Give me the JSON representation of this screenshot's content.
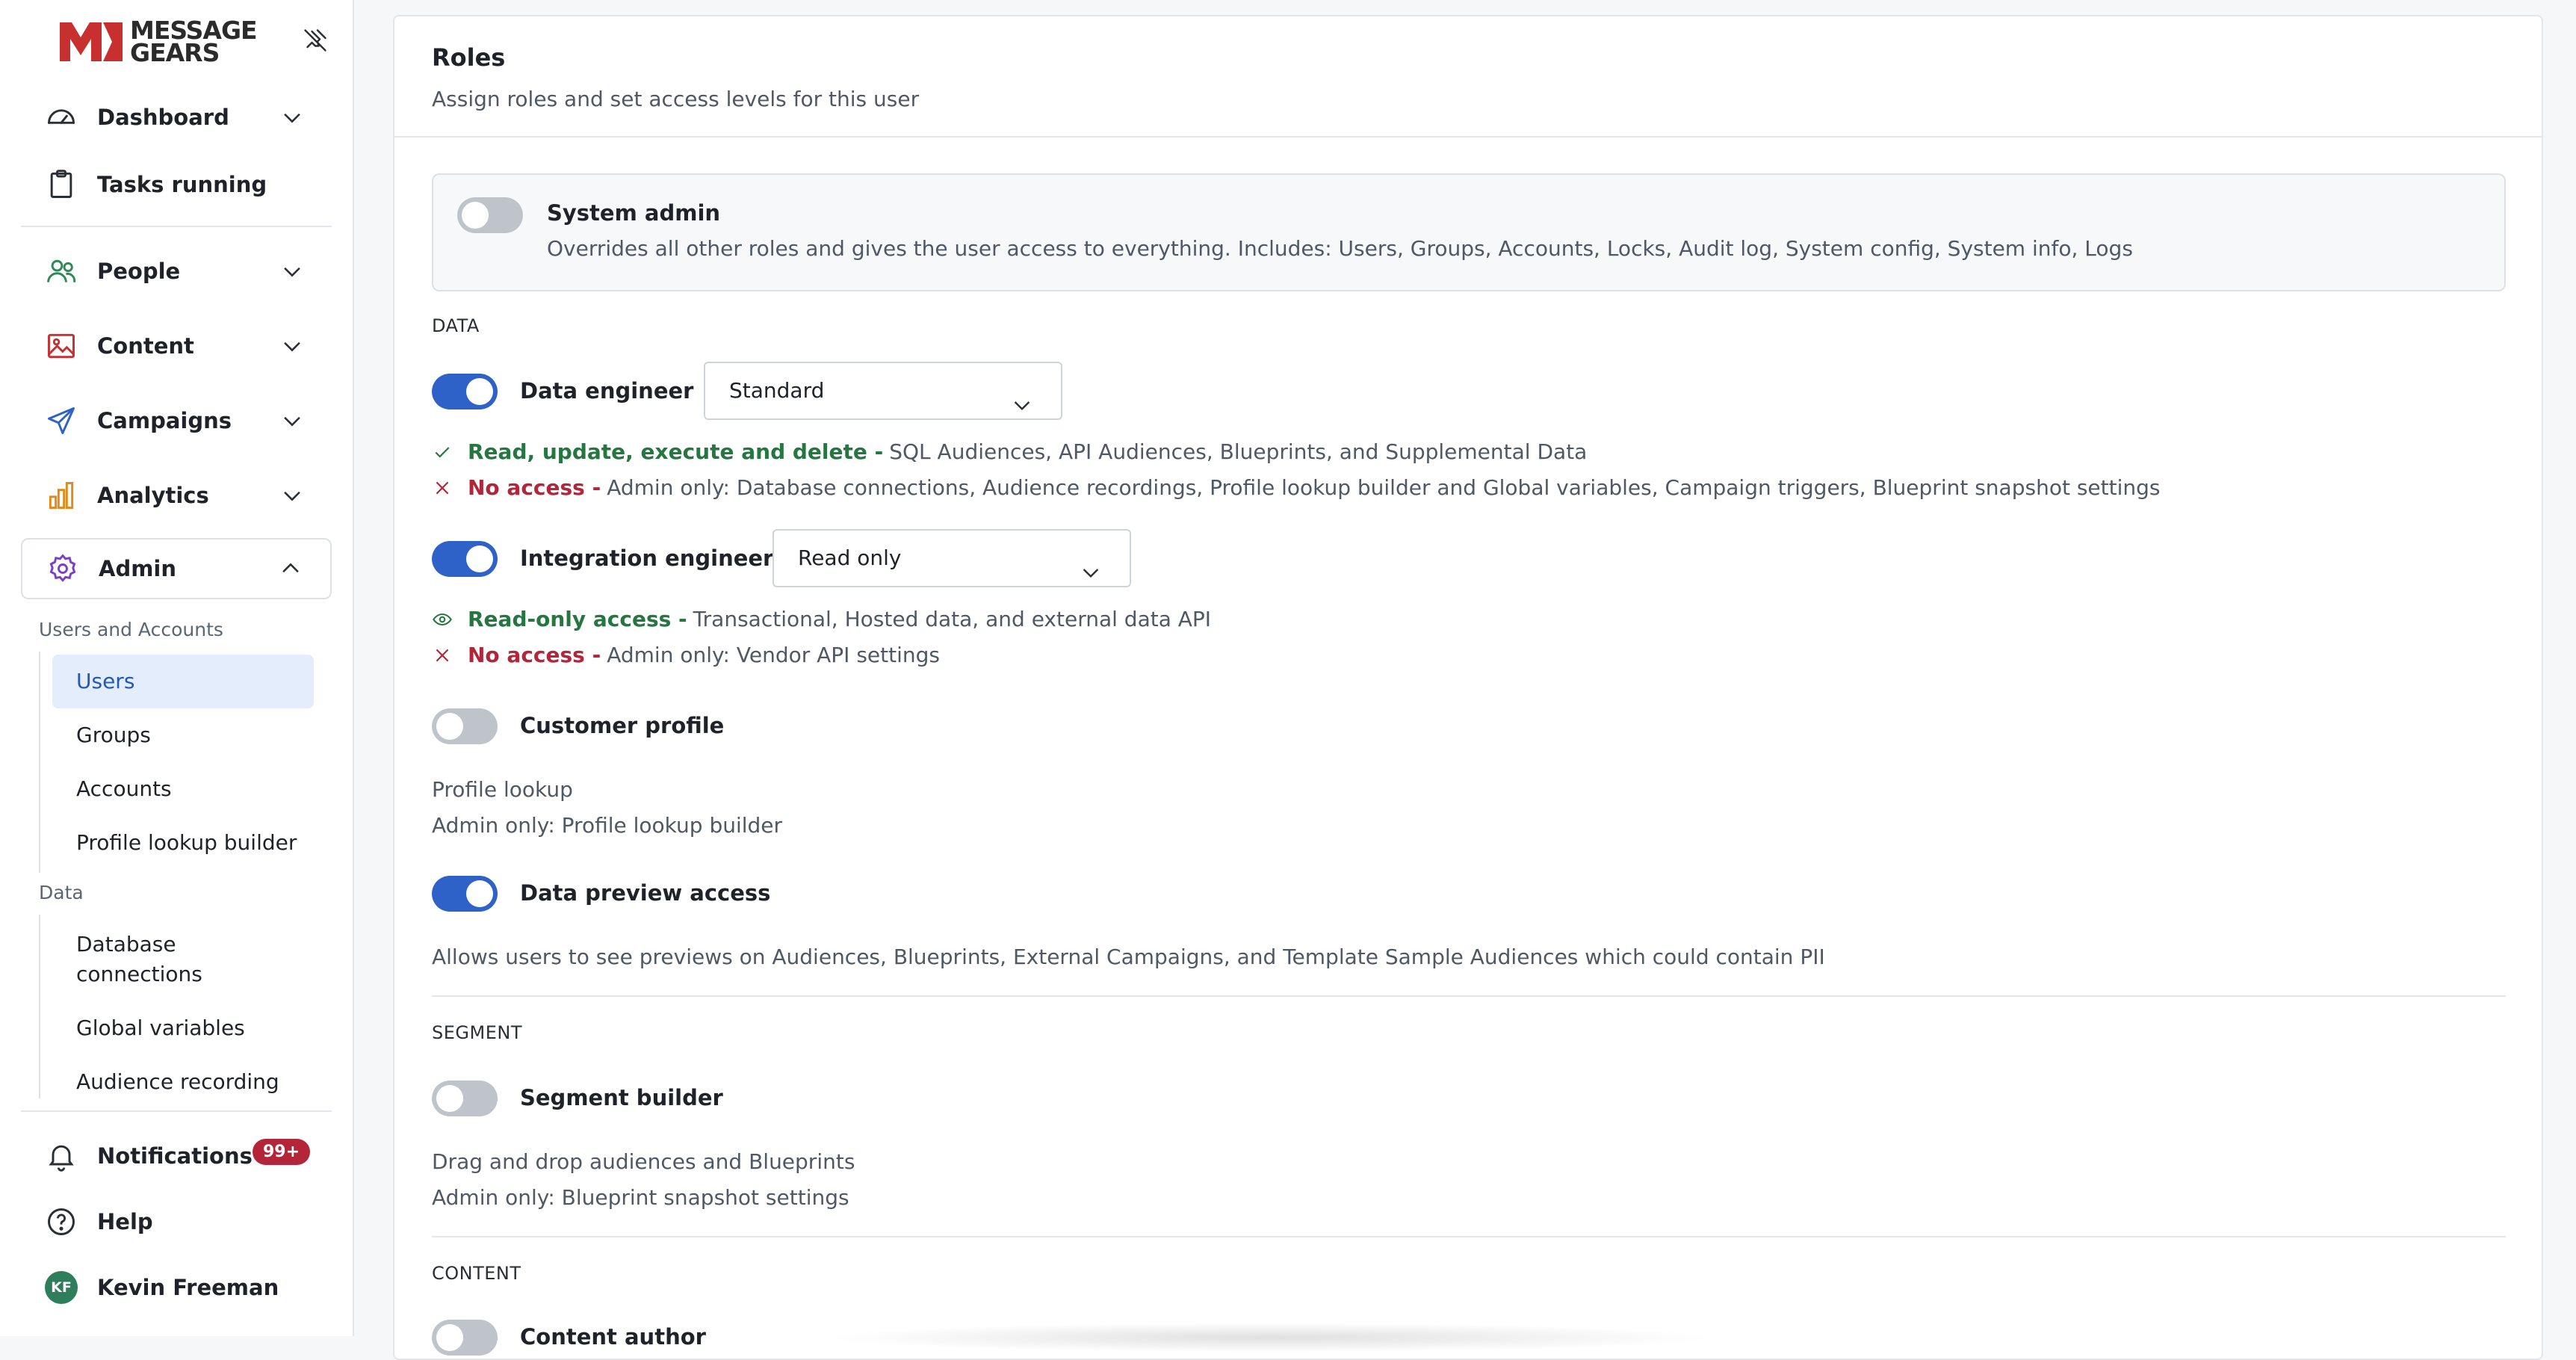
{
  "brand": {
    "line1": "MESSAGE",
    "line2": "GEARS",
    "color": "#c8302f"
  },
  "sidebar": {
    "nav": [
      {
        "label": "Dashboard",
        "icon": "gauge-icon"
      },
      {
        "label": "Tasks running",
        "icon": "clipboard-icon"
      },
      {
        "label": "People",
        "icon": "people-icon"
      },
      {
        "label": "Content",
        "icon": "image-icon"
      },
      {
        "label": "Campaigns",
        "icon": "paper-plane-icon"
      },
      {
        "label": "Analytics",
        "icon": "bar-chart-icon"
      },
      {
        "label": "Admin",
        "icon": "gear-icon"
      }
    ],
    "users_accounts_heading": "Users and Accounts",
    "users_accounts_items": [
      "Users",
      "Groups",
      "Accounts",
      "Profile lookup builder"
    ],
    "data_heading": "Data",
    "data_items": [
      "Database connections",
      "Global variables",
      "Audience recording"
    ],
    "notifications": {
      "label": "Notifications",
      "badge": "99+"
    },
    "help": "Help",
    "user": {
      "initials": "KF",
      "name": "Kevin Freeman"
    }
  },
  "main": {
    "title": "Roles",
    "subtitle": "Assign roles and set access levels for this user",
    "system_admin": {
      "label": "System admin",
      "description": "Overrides all other roles and gives the user access to everything. Includes: Users, Groups, Accounts, Locks, Audit log, System config, System info, Logs",
      "enabled": false
    },
    "sections": {
      "data": "DATA",
      "segment": "SEGMENT",
      "content": "CONTENT"
    },
    "data_engineer": {
      "label": "Data engineer",
      "enabled": true,
      "level": "Standard",
      "allow_label": "Read, update, execute and delete -",
      "allow_text": "SQL Audiences, API Audiences, Blueprints, and Supplemental Data",
      "deny_label": "No access -",
      "deny_text": "Admin only: Database connections, Audience recordings, Profile lookup builder and Global variables, Campaign triggers, Blueprint snapshot settings"
    },
    "integration_engineer": {
      "label": "Integration engineer",
      "enabled": true,
      "level": "Read only",
      "allow_label": "Read-only access -",
      "allow_text": "Transactional, Hosted data, and external data API",
      "deny_label": "No access -",
      "deny_text": "Admin only: Vendor API settings"
    },
    "customer_profile": {
      "label": "Customer profile",
      "enabled": false,
      "desc1": "Profile lookup",
      "desc2": "Admin only: Profile lookup builder"
    },
    "data_preview": {
      "label": "Data preview access",
      "enabled": true,
      "desc": "Allows users to see previews on Audiences, Blueprints, External Campaigns, and Template Sample Audiences which could contain PII"
    },
    "segment_builder": {
      "label": "Segment builder",
      "enabled": false,
      "desc1": "Drag and drop audiences and Blueprints",
      "desc2": "Admin only: Blueprint snapshot settings"
    },
    "content_author": {
      "label": "Content author",
      "enabled": false
    }
  }
}
